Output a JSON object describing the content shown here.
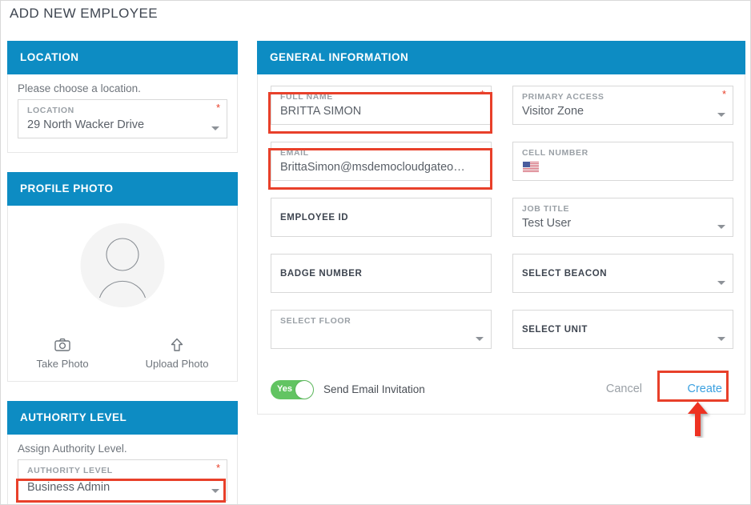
{
  "page": {
    "title": "ADD NEW EMPLOYEE"
  },
  "colors": {
    "header_blue": "#0d8cc3",
    "highlight_red": "#e8402a",
    "toggle_green": "#62c462",
    "link_blue": "#3ba0e0"
  },
  "location_card": {
    "header": "LOCATION",
    "helper": "Please choose a location.",
    "field": {
      "label": "LOCATION",
      "value": "29 North Wacker Drive",
      "required": "*",
      "caret": "chevron-down-icon"
    }
  },
  "profile_card": {
    "header": "PROFILE PHOTO",
    "avatar_icon": "user-avatar-icon",
    "actions": [
      {
        "label": "Take Photo",
        "icon": "camera-icon"
      },
      {
        "label": "Upload Photo",
        "icon": "upload-arrow-icon"
      }
    ]
  },
  "authority_card": {
    "header": "AUTHORITY LEVEL",
    "helper": "Assign Authority Level.",
    "field": {
      "label": "AUTHORITY LEVEL",
      "value": "Business Admin",
      "required": "*",
      "caret": "chevron-down-icon"
    }
  },
  "general_card": {
    "header": "GENERAL INFORMATION",
    "fields": [
      {
        "label": "FULL NAME",
        "value": "BRITTA SIMON",
        "required": "*",
        "caret": false,
        "label_style": "floating",
        "highlighted": true
      },
      {
        "label": "PRIMARY ACCESS",
        "value": "Visitor Zone",
        "required": "*",
        "caret": true,
        "label_style": "floating",
        "highlighted": false
      },
      {
        "label": "EMAIL",
        "value": "BrittaSimon@msdemocloudgateo…",
        "required": "",
        "caret": false,
        "label_style": "floating",
        "highlighted": true
      },
      {
        "label": "CELL NUMBER",
        "value": "",
        "required": "",
        "caret": false,
        "label_style": "floating",
        "highlighted": false,
        "icon": "us-flag-icon"
      },
      {
        "label": "EMPLOYEE ID",
        "value": "",
        "required": "",
        "caret": false,
        "label_style": "centered",
        "highlighted": false
      },
      {
        "label": "JOB TITLE",
        "value": "Test User",
        "required": "",
        "caret": true,
        "label_style": "floating",
        "highlighted": false
      },
      {
        "label": "BADGE NUMBER",
        "value": "",
        "required": "",
        "caret": false,
        "label_style": "centered",
        "highlighted": false
      },
      {
        "label": "SELECT BEACON",
        "value": "",
        "required": "",
        "caret": true,
        "label_style": "centered",
        "highlighted": false
      },
      {
        "label": "SELECT FLOOR",
        "value": "",
        "required": "",
        "caret": true,
        "label_style": "floating",
        "highlighted": false
      },
      {
        "label": "SELECT UNIT",
        "value": "",
        "required": "",
        "caret": true,
        "label_style": "centered",
        "highlighted": false
      }
    ],
    "footer": {
      "toggle_state": "Yes",
      "toggle_label": "Send Email Invitation",
      "cancel_label": "Cancel",
      "create_label": "Create"
    }
  },
  "annotations": {
    "arrow_icon": "red-up-arrow-annotation",
    "highlight_boxes": [
      "full-name-field",
      "email-field",
      "authority-level-value",
      "create-button"
    ]
  }
}
